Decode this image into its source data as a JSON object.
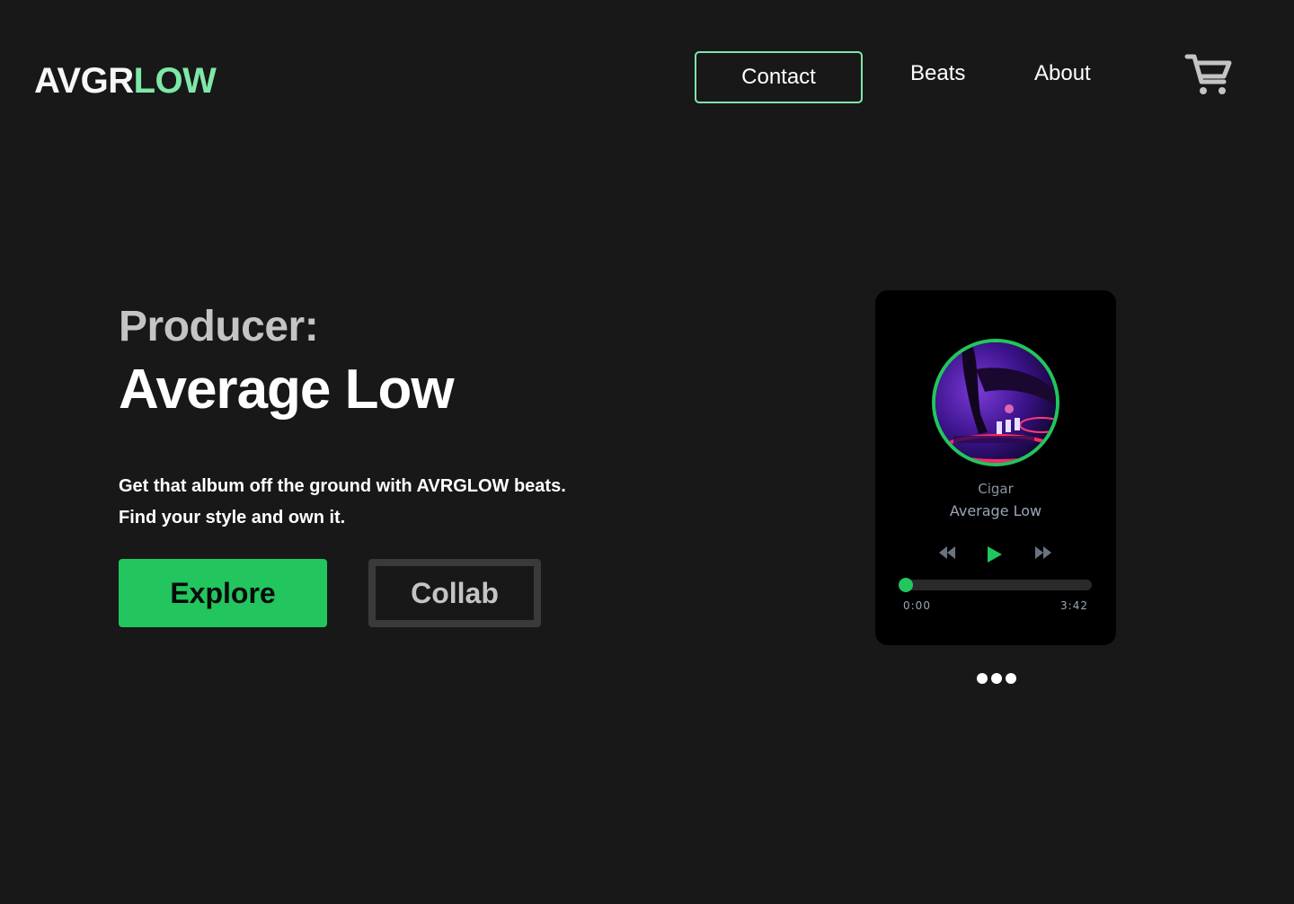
{
  "header": {
    "logo_part1": "AVGR",
    "logo_part2": "LOW",
    "nav": {
      "contact": "Contact",
      "beats": "Beats",
      "about": "About"
    },
    "cart_icon": "shopping-cart-icon"
  },
  "hero": {
    "kicker": "Producer:",
    "title": "Average Low",
    "description_line1": "Get that album off the ground with AVRGLOW beats.",
    "description_line2": "Find your style and own it.",
    "explore_label": "Explore",
    "collab_label": "Collab"
  },
  "player": {
    "song": "Cigar",
    "artist": "Average Low",
    "current_time": "0:00",
    "duration": "3:42",
    "progress": 0.0,
    "icons": [
      "rewind-icon",
      "play-icon",
      "fast-forward-icon"
    ]
  },
  "carousel": {
    "dot_count": 3
  },
  "colors": {
    "background": "#181818",
    "accent_green": "#22c55e",
    "logo_green": "#7ee8a8",
    "muted_gray": "#c4c4c4"
  }
}
